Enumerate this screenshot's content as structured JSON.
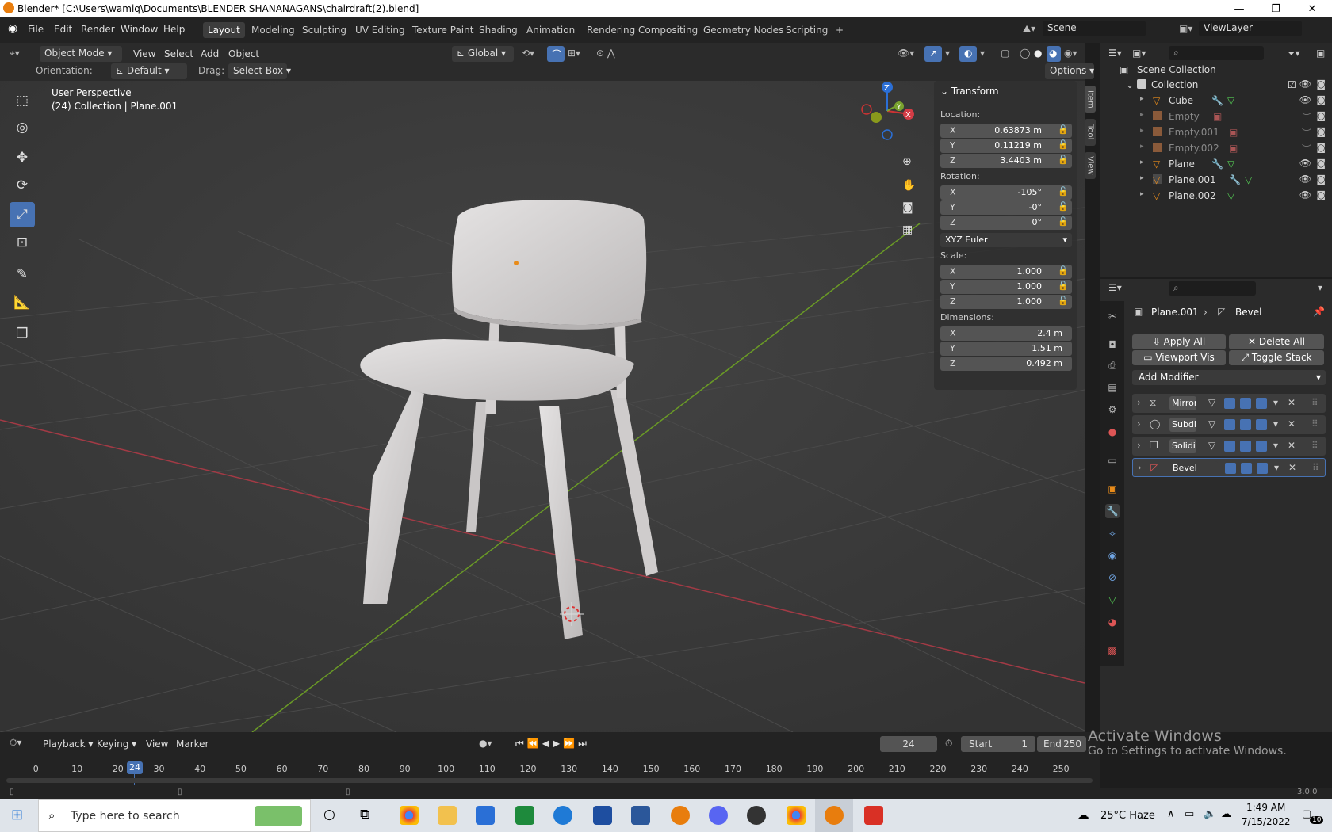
{
  "window": {
    "title": "Blender* [C:\\Users\\wamiq\\Documents\\BLENDER SHANANAGANS\\chairdraft(2).blend]",
    "min": "—",
    "max": "❐",
    "close": "✕"
  },
  "menu": {
    "items": [
      "File",
      "Edit",
      "Render",
      "Window",
      "Help"
    ],
    "workspaces": [
      "Layout",
      "Modeling",
      "Sculpting",
      "UV Editing",
      "Texture Paint",
      "Shading",
      "Animation",
      "Rendering",
      "Compositing",
      "Geometry Nodes",
      "Scripting",
      "+"
    ],
    "scene": "Scene",
    "view_layer": "ViewLayer"
  },
  "header": {
    "mode": "Object Mode",
    "view": "View",
    "select": "Select",
    "add": "Add",
    "object": "Object",
    "transform_orientation": "Global",
    "orientation_label": "Orientation:",
    "orientation_value": "Default",
    "drag_label": "Drag:",
    "drag_value": "Select Box",
    "options": "Options"
  },
  "viewport": {
    "perspective": "User Perspective",
    "collection": "(24) Collection | Plane.001",
    "gizmo": {
      "x": "X",
      "y": "Y",
      "z": "Z"
    }
  },
  "npanel": {
    "title": "Transform",
    "location_label": "Location:",
    "location": {
      "x": "0.63873 m",
      "y": "0.11219 m",
      "z": "3.4403 m"
    },
    "rotation_label": "Rotation:",
    "rotation": {
      "x": "-105°",
      "y": "-0°",
      "z": "0°"
    },
    "rotation_mode": "XYZ Euler",
    "scale_label": "Scale:",
    "scale": {
      "x": "1.000",
      "y": "1.000",
      "z": "1.000"
    },
    "dimensions_label": "Dimensions:",
    "dimensions": {
      "x": "2.4 m",
      "y": "1.51 m",
      "z": "0.492 m"
    },
    "axis": {
      "x": "X",
      "y": "Y",
      "z": "Z"
    },
    "tabs": [
      "Item",
      "Tool",
      "View"
    ]
  },
  "outliner": {
    "scene_collection": "Scene Collection",
    "items": [
      {
        "name": "Collection",
        "dim": false
      },
      {
        "name": "Cube",
        "dim": false
      },
      {
        "name": "Empty",
        "dim": true
      },
      {
        "name": "Empty.001",
        "dim": true
      },
      {
        "name": "Empty.002",
        "dim": true
      },
      {
        "name": "Plane",
        "dim": false
      },
      {
        "name": "Plane.001",
        "dim": false
      },
      {
        "name": "Plane.002",
        "dim": false
      }
    ]
  },
  "properties": {
    "object": "Plane.001",
    "modifier": "Bevel",
    "apply_all": "Apply All",
    "delete_all": "Delete All",
    "viewport_vis": "Viewport Vis",
    "toggle_stack": "Toggle Stack",
    "add_modifier": "Add Modifier",
    "modifiers": [
      "Mirror",
      "Subdi...",
      "Solidify",
      "Bevel"
    ]
  },
  "timeline": {
    "playback": "Playback",
    "keying": "Keying",
    "view": "View",
    "marker": "Marker",
    "current_frame": "24",
    "start_label": "Start",
    "start": "1",
    "end_label": "End",
    "end": "250",
    "ticks": [
      "0",
      "10",
      "20",
      "30",
      "40",
      "50",
      "60",
      "70",
      "80",
      "90",
      "100",
      "110",
      "120",
      "130",
      "140",
      "150",
      "160",
      "170",
      "180",
      "190",
      "200",
      "210",
      "220",
      "230",
      "240",
      "250"
    ]
  },
  "status": {
    "version": "3.0.0"
  },
  "watermark": {
    "line1": "Activate Windows",
    "line2": "Go to Settings to activate Windows."
  },
  "taskbar": {
    "search": "Type here to search",
    "weather": "25°C Haze",
    "time": "1:49 AM",
    "date": "7/15/2022",
    "notif": "10"
  }
}
